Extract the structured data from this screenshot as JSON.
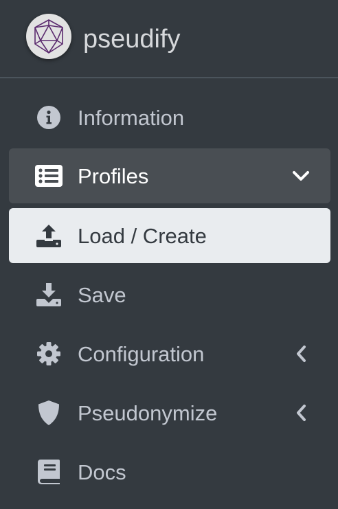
{
  "brand": {
    "name": "pseudify",
    "logo_icon": "polyhedron-logo-icon"
  },
  "colors": {
    "sidebar_bg": "#343a40",
    "open_bg": "#494e53",
    "active_bg": "#e9ecef",
    "text": "#c2c7d0",
    "logo_stroke": "#5b2a6e"
  },
  "nav": {
    "items": [
      {
        "label": "Information",
        "icon": "info-circle-icon"
      },
      {
        "label": "Profiles",
        "icon": "list-alt-icon",
        "expanded": true,
        "chevron": "chevron-down-icon"
      },
      {
        "label": "Load / Create",
        "icon": "upload-icon",
        "active": true
      },
      {
        "label": "Save",
        "icon": "download-icon"
      },
      {
        "label": "Configuration",
        "icon": "gear-icon",
        "chevron": "chevron-left-icon"
      },
      {
        "label": "Pseudonymize",
        "icon": "shield-icon",
        "chevron": "chevron-left-icon"
      },
      {
        "label": "Docs",
        "icon": "book-icon"
      }
    ]
  }
}
